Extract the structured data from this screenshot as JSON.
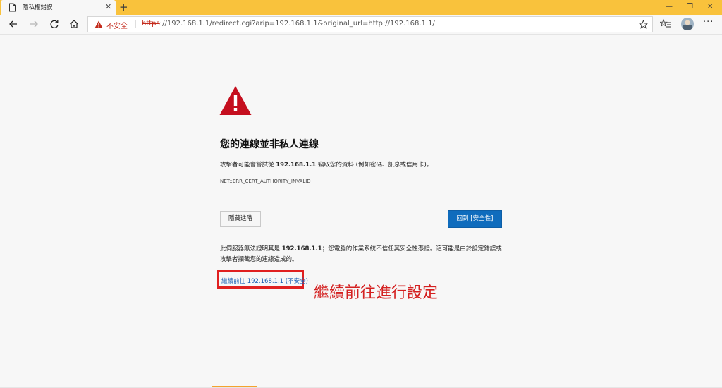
{
  "browser": {
    "tab": {
      "title": "隱私權錯誤",
      "close_glyph": "✕",
      "icon": "document-icon"
    },
    "new_tab_glyph": "+",
    "window_controls": {
      "minimize": "—",
      "maximize": "❐",
      "close": "✕"
    },
    "address_bar": {
      "security_label": "不安全",
      "separator": "|",
      "url_protocol": "https",
      "url_rest": "://192.168.1.1/redirect.cgi?arip=192.168.1.1&original_url=http://192.168.1.1/"
    },
    "more_glyph": "···"
  },
  "page": {
    "heading": "您的連線並非私人連線",
    "desc_prefix": "攻擊者可能會嘗試從 ",
    "desc_host": "192.168.1.1",
    "desc_suffix": " 竊取您的資料 (例如密碼、訊息或信用卡)。",
    "error_code": "NET::ERR_CERT_AUTHORITY_INVALID",
    "hide_advanced_button": "隱藏進階",
    "back_to_safety_button": "回到 [安全性]",
    "details_prefix": "此伺服器無法證明其是 ",
    "details_host": "192.168.1.1",
    "details_suffix": "；您電腦的作業系統不信任其安全性憑證。這可能是由於設定錯誤或攻擊者攔截您的連線造成的。",
    "proceed_link": "繼續前往 192.168.1.1 (不安全)"
  },
  "annotation": {
    "text": "繼續前往進行設定",
    "color": "#d42020"
  },
  "colors": {
    "titlebar": "#f9c23c",
    "warning_red": "#c42b1c",
    "primary_button": "#0f6cbd",
    "link": "#1a5fb4"
  }
}
